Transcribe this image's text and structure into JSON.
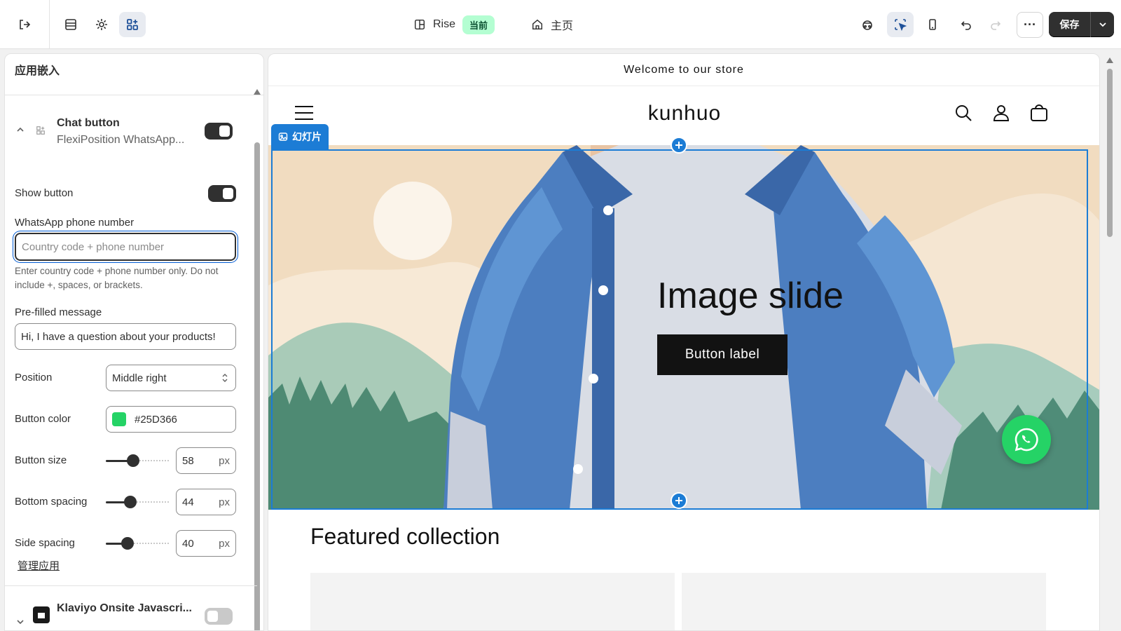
{
  "topbar": {
    "theme_name": "Rise",
    "current_badge": "当前",
    "page_name": "主页",
    "save_label": "保存"
  },
  "sidebar": {
    "title": "应用嵌入",
    "embed": {
      "title": "Chat button",
      "subtitle": "FlexiPosition WhatsApp...",
      "enabled": true
    },
    "show_button": {
      "label": "Show button",
      "enabled": true
    },
    "phone": {
      "label": "WhatsApp phone number",
      "placeholder": "Country code + phone number",
      "help": "Enter country code + phone number only. Do not include +, spaces, or brackets."
    },
    "message": {
      "label": "Pre-filled message",
      "value": "Hi, I have a question about your products!"
    },
    "position": {
      "label": "Position",
      "value": "Middle right"
    },
    "button_color": {
      "label": "Button color",
      "value": "#25D366"
    },
    "button_size": {
      "label": "Button size",
      "value": "58",
      "unit": "px"
    },
    "bottom_spacing": {
      "label": "Bottom spacing",
      "value": "44",
      "unit": "px"
    },
    "side_spacing": {
      "label": "Side spacing",
      "value": "40",
      "unit": "px"
    },
    "manage_link": "管理应用",
    "next_embed": {
      "title": "Klaviyo Onsite Javascri...",
      "enabled": false
    }
  },
  "preview": {
    "announcement": "Welcome to our store",
    "store_name": "kunhuo",
    "section_tag": "幻灯片",
    "slide_heading": "Image slide",
    "slide_button": "Button label",
    "featured_title": "Featured collection"
  },
  "colors": {
    "accent": "#1c7cd5",
    "whatsapp": "#25D366",
    "dark": "#303030"
  }
}
